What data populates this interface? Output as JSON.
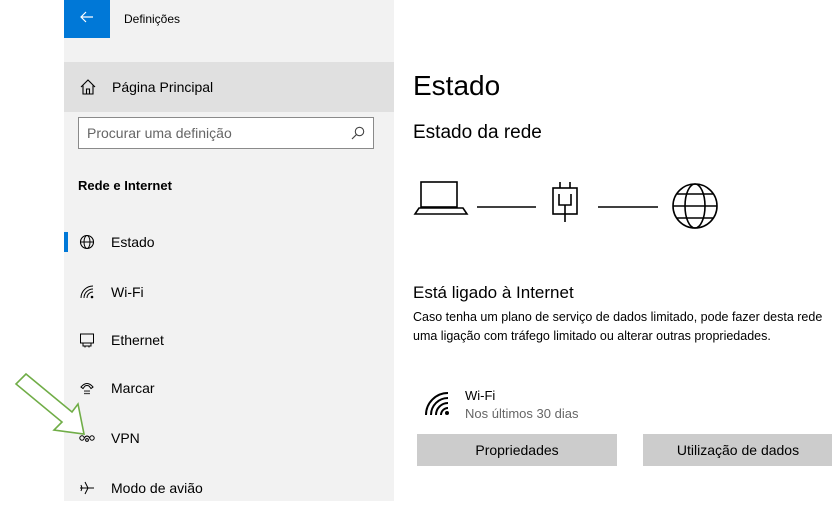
{
  "window": {
    "title": "Definições",
    "back_icon": "arrow-left-icon",
    "accent": "#0078d7"
  },
  "sidebar": {
    "home_label": "Página Principal",
    "search_placeholder": "Procurar uma definição",
    "section_title": "Rede e Internet",
    "items": [
      {
        "label": "Estado",
        "icon": "globe-icon",
        "active": true
      },
      {
        "label": "Wi-Fi",
        "icon": "wifi-icon"
      },
      {
        "label": "Ethernet",
        "icon": "ethernet-icon"
      },
      {
        "label": "Marcar",
        "icon": "dialup-icon"
      },
      {
        "label": "VPN",
        "icon": "vpn-icon"
      },
      {
        "label": "Modo de avião",
        "icon": "airplane-icon"
      }
    ]
  },
  "main": {
    "title": "Estado",
    "network_status_title": "Estado da rede",
    "connected_title": "Está ligado à Internet",
    "description": "Caso tenha um plano de serviço de dados limitado, pode fazer desta rede uma ligação com tráfego limitado ou alterar outras propriedades.",
    "connection": {
      "name": "Wi-Fi",
      "subtitle": "Nos últimos 30 dias"
    },
    "buttons": {
      "properties": "Propriedades",
      "data_usage": "Utilização de dados"
    }
  },
  "annotation": {
    "arrow_color": "#70ad47"
  }
}
